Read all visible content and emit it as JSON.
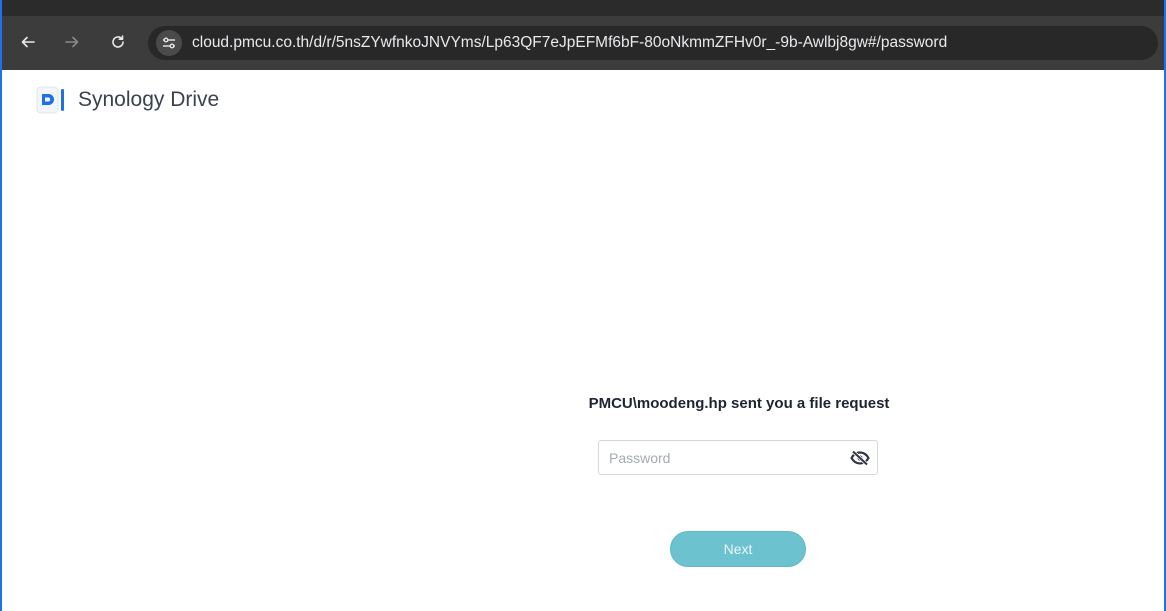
{
  "browser": {
    "back_icon": "arrow-left-icon",
    "forward_icon": "arrow-right-icon",
    "reload_icon": "reload-icon",
    "site_info_icon": "tune-icon",
    "url": "cloud.pmcu.co.th/d/r/5nsZYwfnkoJNVYms/Lp63QF7eJpEFMf6bF-80oNkmmZFHv0r_-9b-Awlbj8gw#/password"
  },
  "app": {
    "name": "Synology Drive",
    "logo_icon": "synology-drive-logo"
  },
  "request": {
    "title": "PMCU\\moodeng.hp sent you a file request"
  },
  "password": {
    "placeholder": "Password",
    "value": "",
    "toggle_icon": "eye-off-icon"
  },
  "actions": {
    "next_label": "Next"
  },
  "colors": {
    "toolbar": "#3c3c3c",
    "address_bar": "#282828",
    "accent_border": "#1a73e8",
    "next_button": "#6cc3cf",
    "logo_blue": "#1f6fe5"
  }
}
